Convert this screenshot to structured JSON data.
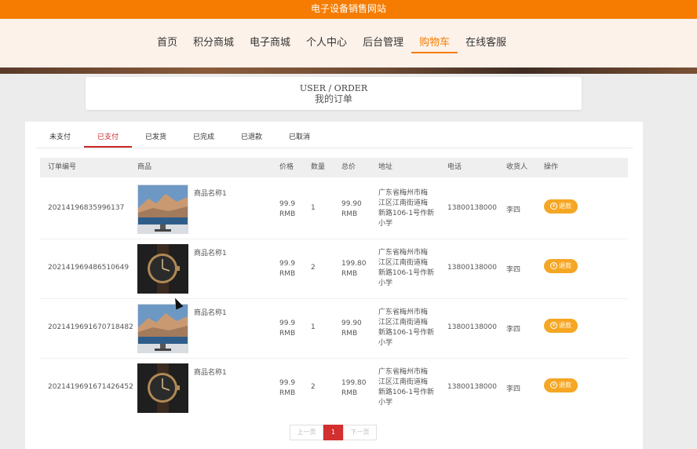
{
  "site": {
    "title": "电子设备销售网站"
  },
  "nav": {
    "items": [
      "首页",
      "积分商城",
      "电子商城",
      "个人中心",
      "后台管理",
      "购物车",
      "在线客服"
    ],
    "active_index": 5
  },
  "header": {
    "title_en": "USER / ORDER",
    "title_cn": "我的订单"
  },
  "tabs": {
    "items": [
      "未支付",
      "已支付",
      "已发货",
      "已完成",
      "已退款",
      "已取消"
    ],
    "active_index": 1
  },
  "table": {
    "headers": [
      "订单编号",
      "商品",
      "价格",
      "数量",
      "总价",
      "地址",
      "电话",
      "收货人",
      "操作"
    ],
    "rows": [
      {
        "order_no": "20214196835996137",
        "product": "商品名称1",
        "price": "99.9",
        "price_unit": "RMB",
        "qty": "1",
        "total": "99.90",
        "total_unit": "RMB",
        "addr1": "广东省梅州市梅",
        "addr2": "江区江南街道梅",
        "addr3": "新路106-1号作新",
        "addr4": "小学",
        "phone": "13800138000",
        "receiver": "李四",
        "action": "退款",
        "image": "landscape"
      },
      {
        "order_no": "20214196948651064​9",
        "product": "商品名称1",
        "price": "99.9",
        "price_unit": "RMB",
        "qty": "2",
        "total": "199.80",
        "total_unit": "RMB",
        "addr1": "广东省梅州市梅",
        "addr2": "江区江南街道梅",
        "addr3": "新路106-1号作新",
        "addr4": "小学",
        "phone": "13800138000",
        "receiver": "李四",
        "action": "退款",
        "image": "watch"
      },
      {
        "order_no": "20214196916707184​82",
        "product": "商品名称1",
        "price": "99.9",
        "price_unit": "RMB",
        "qty": "1",
        "total": "99.90",
        "total_unit": "RMB",
        "addr1": "广东省梅州市梅",
        "addr2": "江区江南街道梅",
        "addr3": "新路106-1号作新",
        "addr4": "小学",
        "phone": "13800138000",
        "receiver": "李四",
        "action": "退款",
        "image": "landscape"
      },
      {
        "order_no": "20214196916714264​52",
        "product": "商品名称1",
        "price": "99.9",
        "price_unit": "RMB",
        "qty": "2",
        "total": "199.80",
        "total_unit": "RMB",
        "addr1": "广东省梅州市梅",
        "addr2": "江区江南街道梅",
        "addr3": "新路106-1号作新",
        "addr4": "小学",
        "phone": "13800138000",
        "receiver": "李四",
        "action": "退款",
        "image": "watch"
      }
    ]
  },
  "pager": {
    "prev": "上一页",
    "current": "1",
    "next": "下一页"
  },
  "icons": {
    "refund_icon": "refund-icon"
  },
  "colors": {
    "accent": "#f57c00",
    "active_tab": "#c62828",
    "refund_button": "#f5a623",
    "pager_current": "#d32f2f"
  }
}
